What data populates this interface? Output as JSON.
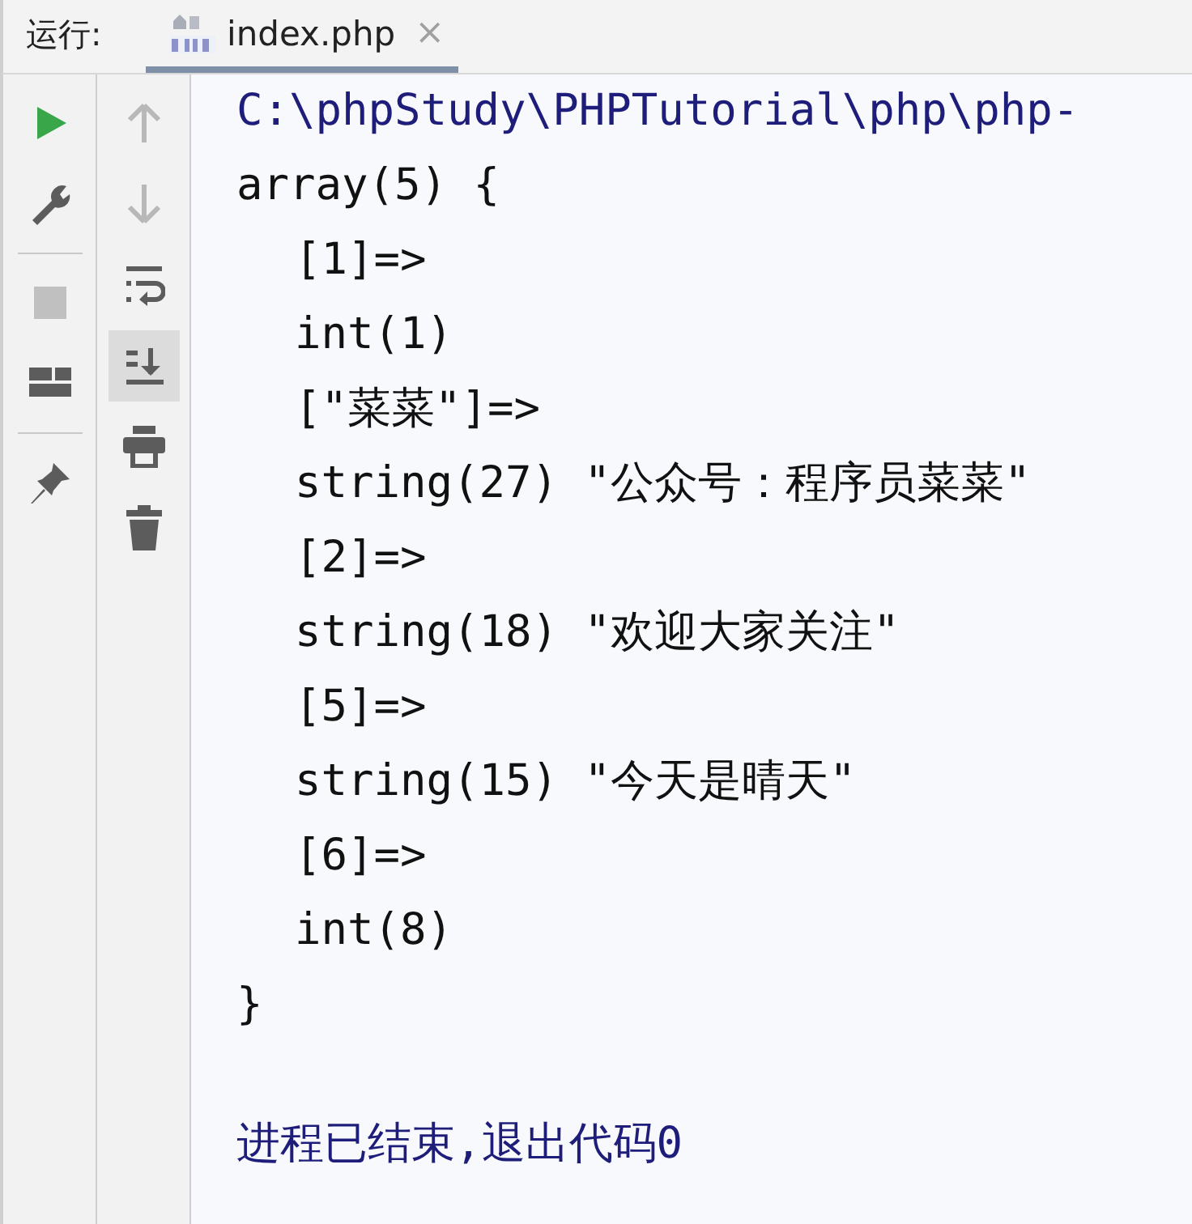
{
  "header": {
    "label": "运行:",
    "tabs": [
      {
        "title": "index.php",
        "close": "×",
        "selected": true
      }
    ]
  },
  "toolbar_left": [
    {
      "kind": "run",
      "disabled": false
    },
    {
      "kind": "wrench",
      "disabled": false
    },
    {
      "kind": "separator"
    },
    {
      "kind": "stop",
      "disabled": true
    },
    {
      "kind": "layout",
      "disabled": false
    },
    {
      "kind": "separator"
    },
    {
      "kind": "pin",
      "disabled": false
    }
  ],
  "toolbar_right": [
    {
      "kind": "up",
      "disabled": true,
      "on": false
    },
    {
      "kind": "down",
      "disabled": true,
      "on": false
    },
    {
      "kind": "wrap",
      "disabled": false,
      "on": false
    },
    {
      "kind": "scroll-end",
      "disabled": false,
      "on": true
    },
    {
      "kind": "print",
      "disabled": false,
      "on": false
    },
    {
      "kind": "trash",
      "disabled": false,
      "on": false
    }
  ],
  "console": [
    {
      "kind": "path",
      "text": "C:\\phpStudy\\PHPTutorial\\php\\php-"
    },
    {
      "text": "array(5) {",
      "children": [
        {
          "text": "[1]=>"
        },
        {
          "text": "int(1)"
        },
        {
          "text": "[\"菜菜\"]=>"
        },
        {
          "text": "string(27) \"公众号：程序员菜菜\""
        },
        {
          "text": "[2]=>"
        },
        {
          "text": "string(18) \"欢迎大家关注\""
        },
        {
          "text": "[5]=>"
        },
        {
          "text": "string(15) \"今天是晴天\""
        },
        {
          "text": "[6]=>"
        },
        {
          "text": "int(8)"
        }
      ]
    },
    {
      "text": "}"
    },
    {
      "kind": "exit",
      "text": "进程已结束,退出代码0"
    }
  ]
}
